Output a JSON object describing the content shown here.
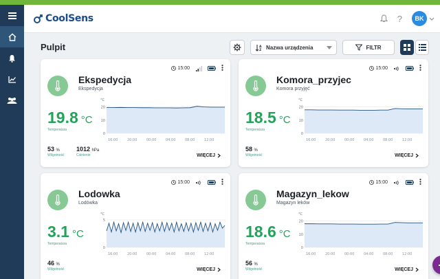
{
  "app": {
    "name": "CoolSens",
    "avatar_initials": "BK",
    "accent": "#23a35a",
    "sidebar_color": "#1f3b57"
  },
  "sidebar": {
    "items": [
      {
        "icon": "menu-icon"
      },
      {
        "icon": "home-icon"
      },
      {
        "icon": "bell-icon"
      },
      {
        "icon": "chart-icon"
      },
      {
        "icon": "users-icon"
      }
    ]
  },
  "toolbar": {
    "title": "Pulpit",
    "sort_label": "Nazwa urządzenia",
    "filter_label": "FILTR"
  },
  "cards": [
    {
      "name": "Ekspedycja",
      "sub": "Ekspedycja",
      "time": "15:00",
      "temp": "19.8",
      "unit": "°C",
      "temp_label": "Temperatura",
      "humidity": "53",
      "humidity_unit": "%",
      "humidity_label": "Wilgotność",
      "pressure": "1012",
      "pressure_unit": "hPa",
      "pressure_label": "Ciśnienie",
      "more": "WIĘCEJ",
      "yticks": [
        "20",
        "10",
        "0"
      ],
      "ylabel": "°C",
      "ylim": [
        0,
        25
      ],
      "xticks": [
        "16:00",
        "20:00",
        "00:00",
        "04:00",
        "08:00",
        "12:00"
      ],
      "series": [
        19.5,
        19.5,
        19.6,
        19.5,
        19.5,
        19.4,
        19.4,
        19.3,
        19.3,
        19.3,
        19.2,
        19.3,
        19.4,
        20.5,
        20.0,
        19.8,
        19.8,
        19.8
      ]
    },
    {
      "name": "Komora_przyjec",
      "sub": "Komora przyjęć",
      "time": "15:00",
      "temp": "18.5",
      "unit": "°C",
      "temp_label": "Temperatura",
      "humidity": "58",
      "humidity_unit": "%",
      "humidity_label": "Wilgotność",
      "more": "WIĘCEJ",
      "yticks": [
        "20",
        "10",
        "0"
      ],
      "ylabel": "°C",
      "ylim": [
        0,
        25
      ],
      "xticks": [
        "16:00",
        "20:00",
        "00:00",
        "04:00",
        "08:00",
        "12:00"
      ],
      "series": [
        17.8,
        17.8,
        17.7,
        17.7,
        17.7,
        17.6,
        17.6,
        17.6,
        17.5,
        17.5,
        17.5,
        17.6,
        17.6,
        18.8,
        18.6,
        18.5,
        18.5,
        18.5
      ]
    },
    {
      "name": "Lodowka",
      "sub": "Lodówka",
      "time": "15:00",
      "temp": "3.1",
      "unit": "°C",
      "temp_label": "Temperatura",
      "humidity": "46",
      "humidity_unit": "%",
      "humidity_label": "Wilgotność",
      "more": "WIĘCEJ",
      "yticks": [
        "5",
        "0"
      ],
      "ylabel": "°C",
      "ylim": [
        0,
        6
      ],
      "xticks": [
        "16:00",
        "20:00",
        "00:00",
        "04:00",
        "08:00",
        "12:00"
      ],
      "series": [
        3.0,
        4.4,
        2.8,
        4.6,
        3.0,
        4.3,
        2.7,
        4.5,
        3.1,
        4.6,
        2.9,
        4.4,
        2.8,
        4.5,
        3.0,
        4.6,
        2.9,
        4.4,
        3.1,
        4.5,
        2.8,
        4.3,
        3.0,
        4.6,
        2.9,
        4.5,
        3.1,
        4.4,
        2.8,
        4.6,
        3.0,
        4.3,
        2.9,
        4.5,
        3.0,
        4.4,
        2.8,
        4.5,
        3.1,
        4.6,
        2.9,
        4.4,
        3.0,
        4.5,
        2.8,
        4.3,
        3.1,
        4.6,
        3.5,
        4.0
      ]
    },
    {
      "name": "Magazyn_lekow",
      "sub": "Magazyn leków",
      "time": "15:00",
      "temp": "18.6",
      "unit": "°C",
      "temp_label": "Temperatura",
      "humidity": "56",
      "humidity_unit": "%",
      "humidity_label": "Wilgotność",
      "more": "WIĘCEJ",
      "yticks": [
        "20",
        "10",
        "0"
      ],
      "ylabel": "°C",
      "ylim": [
        0,
        25
      ],
      "xticks": [
        "16:00",
        "20:00",
        "00:00",
        "04:00",
        "08:00",
        "12:00"
      ],
      "series": [
        17.9,
        17.9,
        17.8,
        17.8,
        17.8,
        17.7,
        17.7,
        17.7,
        17.6,
        17.6,
        17.6,
        17.7,
        17.7,
        18.9,
        18.7,
        18.6,
        18.6,
        18.6
      ]
    }
  ]
}
